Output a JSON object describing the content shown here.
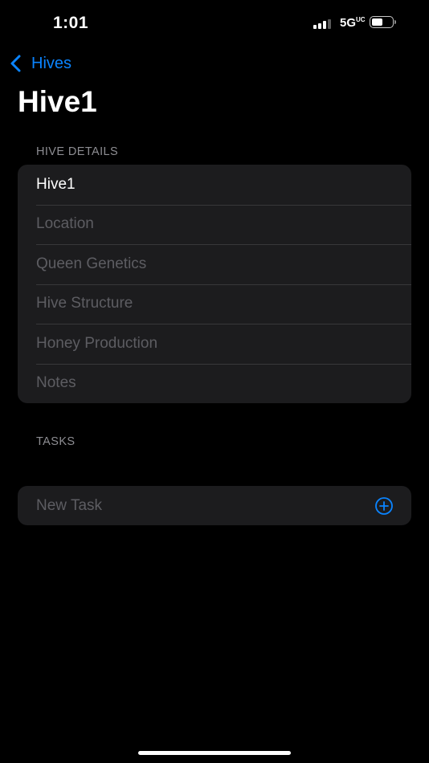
{
  "status_bar": {
    "time": "1:01",
    "network": "5G",
    "network_suffix": "UC",
    "battery_level": 0.55
  },
  "nav": {
    "back_label": "Hives"
  },
  "page_title": "Hive1",
  "hive_details": {
    "header": "HIVE DETAILS",
    "fields": [
      {
        "value": "Hive1",
        "placeholder": ""
      },
      {
        "value": "",
        "placeholder": "Location"
      },
      {
        "value": "",
        "placeholder": "Queen Genetics"
      },
      {
        "value": "",
        "placeholder": "Hive Structure"
      },
      {
        "value": "",
        "placeholder": "Honey Production"
      },
      {
        "value": "",
        "placeholder": "Notes"
      }
    ]
  },
  "tasks": {
    "header": "TASKS",
    "new_task_placeholder": "New Task"
  },
  "colors": {
    "accent": "#0a84ff",
    "background": "#000000",
    "group_background": "#1c1c1e",
    "separator": "#38383a",
    "placeholder": "#5d5d62"
  }
}
